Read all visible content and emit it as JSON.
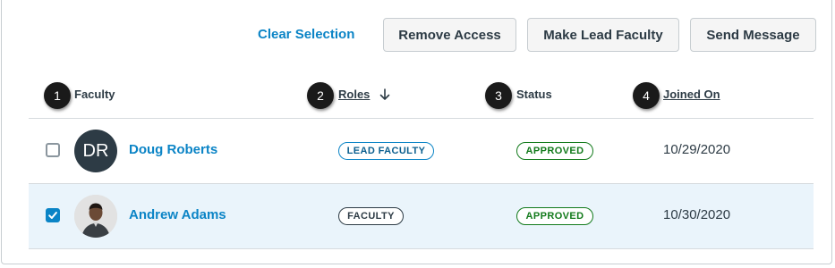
{
  "toolbar": {
    "clear_selection": "Clear Selection",
    "remove_access": "Remove Access",
    "make_lead": "Make Lead Faculty",
    "send_message": "Send Message"
  },
  "columns": {
    "faculty": "Faculty",
    "roles": "Roles",
    "status": "Status",
    "joined_on": "Joined On"
  },
  "callouts": [
    "1",
    "2",
    "3",
    "4"
  ],
  "rows": [
    {
      "selected": false,
      "initials": "DR",
      "name": "Doug Roberts",
      "role": "LEAD FACULTY",
      "status": "APPROVED",
      "joined": "10/29/2020"
    },
    {
      "selected": true,
      "initials": "",
      "name": "Andrew Adams",
      "role": "FACULTY",
      "status": "APPROVED",
      "joined": "10/30/2020"
    }
  ],
  "colors": {
    "link": "#0b84c6",
    "selected_row": "#eaf4fb",
    "approved": "#127a1b",
    "callout": "#1a1a1a"
  },
  "icons": {
    "sort": "arrow-down-icon",
    "check": "checkmark-icon"
  }
}
